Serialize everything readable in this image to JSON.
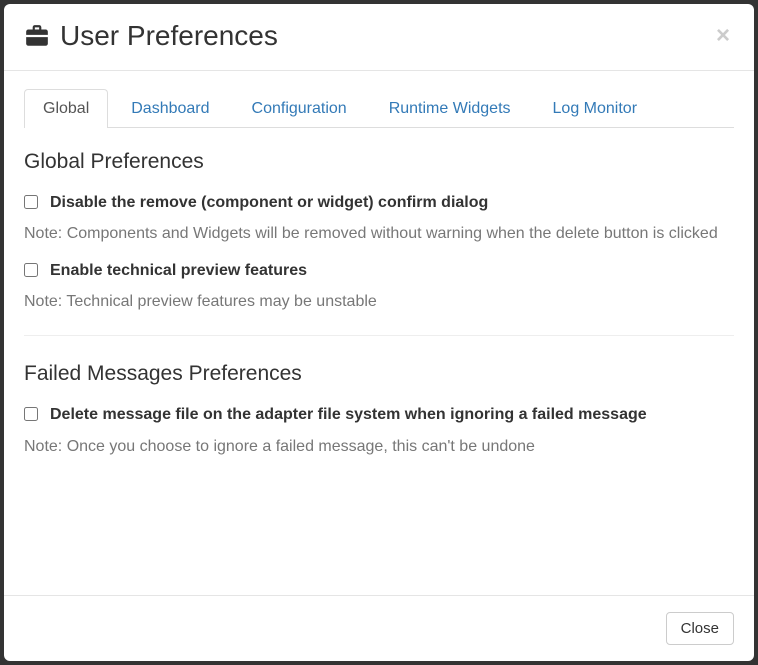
{
  "modal": {
    "title": "User Preferences",
    "close_label": "Close"
  },
  "tabs": [
    {
      "label": "Global",
      "active": true
    },
    {
      "label": "Dashboard",
      "active": false
    },
    {
      "label": "Configuration",
      "active": false
    },
    {
      "label": "Runtime Widgets",
      "active": false
    },
    {
      "label": "Log Monitor",
      "active": false
    }
  ],
  "sections": {
    "global": {
      "title": "Global Preferences",
      "items": [
        {
          "label": "Disable the remove (component or widget) confirm dialog",
          "note": "Note: Components and Widgets will be removed without warning when the delete button is clicked",
          "checked": false
        },
        {
          "label": "Enable technical preview features",
          "note": "Note: Technical preview features may be unstable",
          "checked": false
        }
      ]
    },
    "failed": {
      "title": "Failed Messages Preferences",
      "items": [
        {
          "label": "Delete message file on the adapter file system when ignoring a failed message",
          "note": "Note: Once you choose to ignore a failed message, this can't be undone",
          "checked": false
        }
      ]
    }
  }
}
